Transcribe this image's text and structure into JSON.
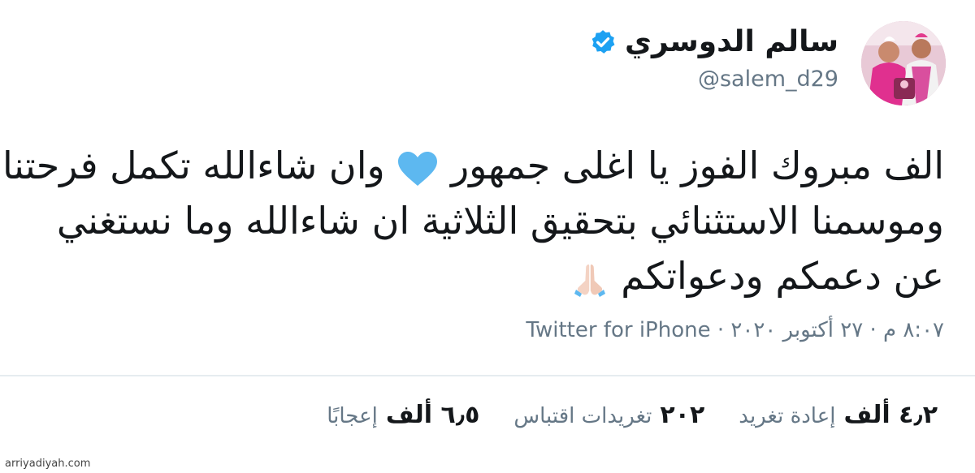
{
  "tweet": {
    "author_name": "سالم الدوسري",
    "handle": "@salem_d29",
    "verified": true,
    "text_lines": [
      "الف مبروك الفوز يا اغلى جمهور ",
      "وان شاءالله تكمل فرحتنا",
      "وموسمنا الاستثنائي بتحقيق الثلاثية ان شاءالله وما نستغني",
      "عن دعمكم ودعواتكم"
    ],
    "emojis": {
      "heart": "blue-heart-icon",
      "hands": "folded-hands-icon"
    },
    "meta": "٨:٠٧ م · ٢٧ أكتوبر ٢٠٢٠ · Twitter for iPhone",
    "stats": {
      "retweets_count": "٤٫٢ ألف",
      "retweets_label": "إعادة تغريد",
      "quotes_count": "٢٠٢",
      "quotes_label": "تغريدات اقتباس",
      "likes_count": "٦٫٥ ألف",
      "likes_label": "إعجابًا"
    },
    "colors": {
      "verified_blue": "#1da1f2",
      "heart_blue": "#5db8f0",
      "text": "#14171a",
      "muted": "#657786"
    }
  },
  "watermark": "arriyadiyah.com"
}
